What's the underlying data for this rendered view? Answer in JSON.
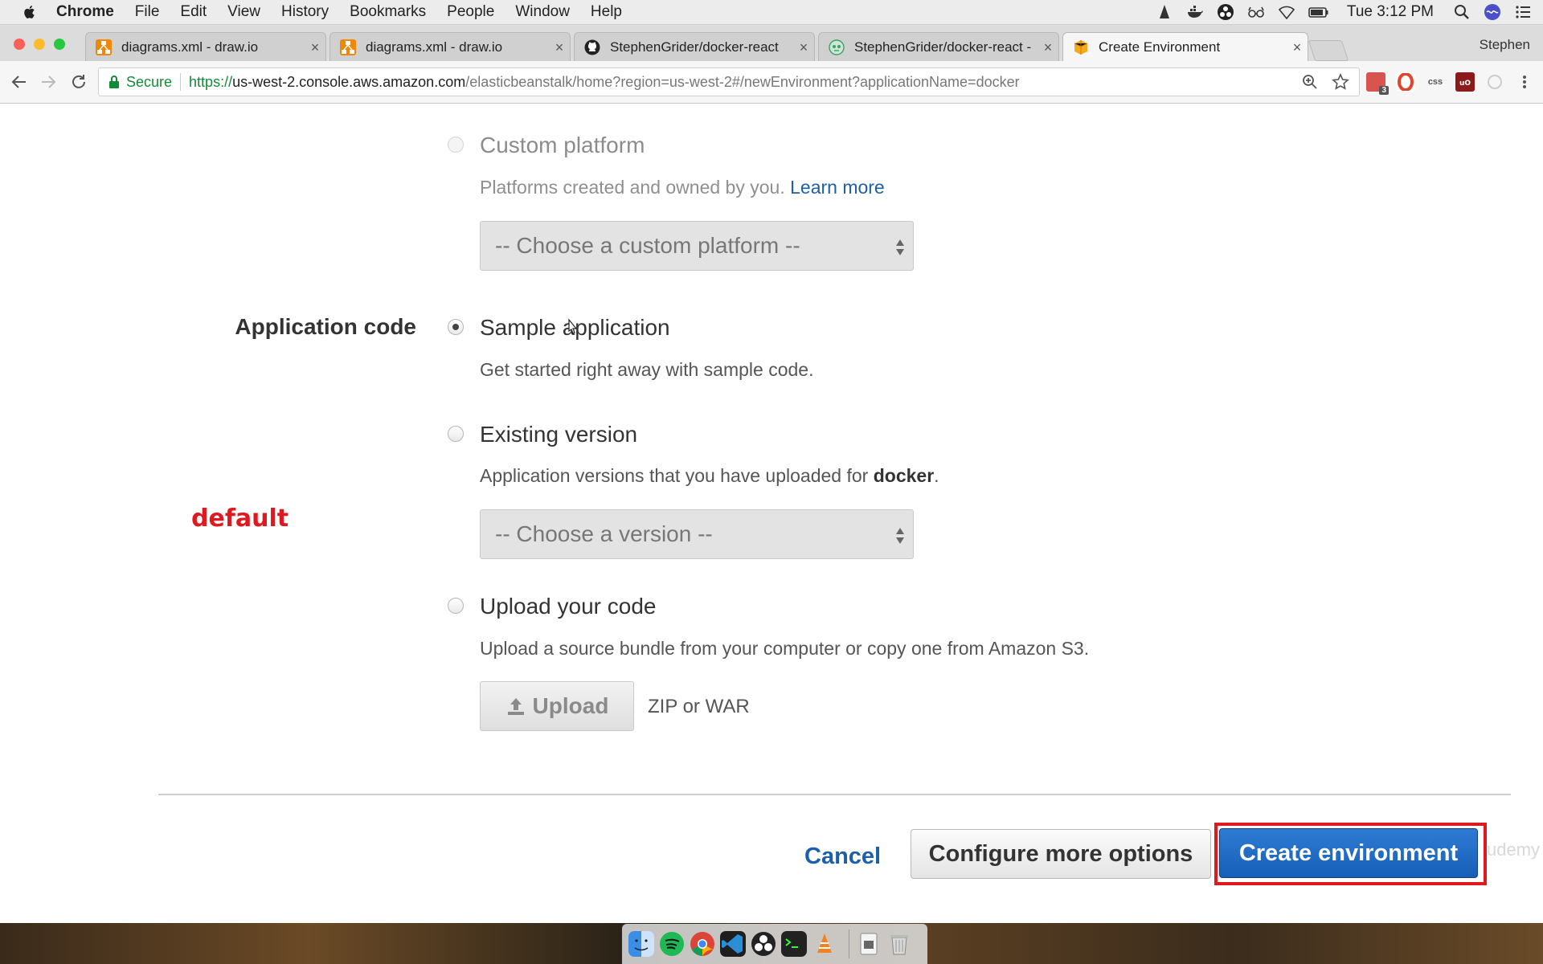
{
  "menubar": {
    "app": "Chrome",
    "items": [
      "File",
      "Edit",
      "View",
      "History",
      "Bookmarks",
      "People",
      "Window",
      "Help"
    ],
    "clock": "Tue 3:12 PM",
    "status_icons": [
      "vlc-icon",
      "docker-icon",
      "obs-icon",
      "glasses-icon",
      "wifi-icon",
      "battery-icon",
      "spotlight-icon",
      "siri-icon",
      "notification-center-icon"
    ]
  },
  "browser": {
    "profile": "Stephen",
    "tabs": [
      {
        "label": "diagrams.xml - draw.io",
        "icon": "drawio-icon",
        "close": "×"
      },
      {
        "label": "diagrams.xml - draw.io",
        "icon": "drawio-icon",
        "close": "×"
      },
      {
        "label": "StephenGrider/docker-react",
        "icon": "github-icon",
        "close": "×"
      },
      {
        "label": "StephenGrider/docker-react -",
        "icon": "travis-icon",
        "close": "×"
      },
      {
        "label": "Create Environment",
        "icon": "aws-icon",
        "close": "×"
      }
    ],
    "url": {
      "secure_label": "Secure",
      "scheme": "https://",
      "host": "us-west-2.console.aws.amazon.com",
      "path": "/elasticbeanstalk/home?region=us-west-2#/newEnvironment?applicationName=docker"
    },
    "extensions": {
      "badge_count": "3",
      "css_label": "css"
    }
  },
  "form": {
    "custom_platform": {
      "title": "Custom platform",
      "desc": "Platforms created and owned by you.",
      "learn_more": "Learn more",
      "select_value": "-- Choose a custom platform --"
    },
    "app_code": {
      "section_label": "Application code",
      "sample": {
        "title": "Sample application",
        "desc": "Get started right away with sample code.",
        "selected": true
      },
      "existing": {
        "title": "Existing version",
        "desc_prefix": "Application versions that you have uploaded for",
        "app_name": "docker",
        "desc_suffix": ".",
        "select_value": "-- Choose a version --"
      },
      "upload": {
        "title": "Upload your code",
        "desc": "Upload a source bundle from your computer or copy one from Amazon S3.",
        "button_label": "Upload",
        "hint": "ZIP or WAR"
      }
    },
    "annotation": "default"
  },
  "actions": {
    "cancel": "Cancel",
    "configure": "Configure more options",
    "create": "Create environment"
  },
  "watermark": "udemy",
  "dock": {
    "apps": [
      "finder-icon",
      "spotify-icon",
      "chrome-icon",
      "vscode-icon",
      "obs-icon",
      "terminal-icon",
      "vlc-icon"
    ],
    "right": [
      "documents-icon",
      "trash-icon"
    ]
  }
}
